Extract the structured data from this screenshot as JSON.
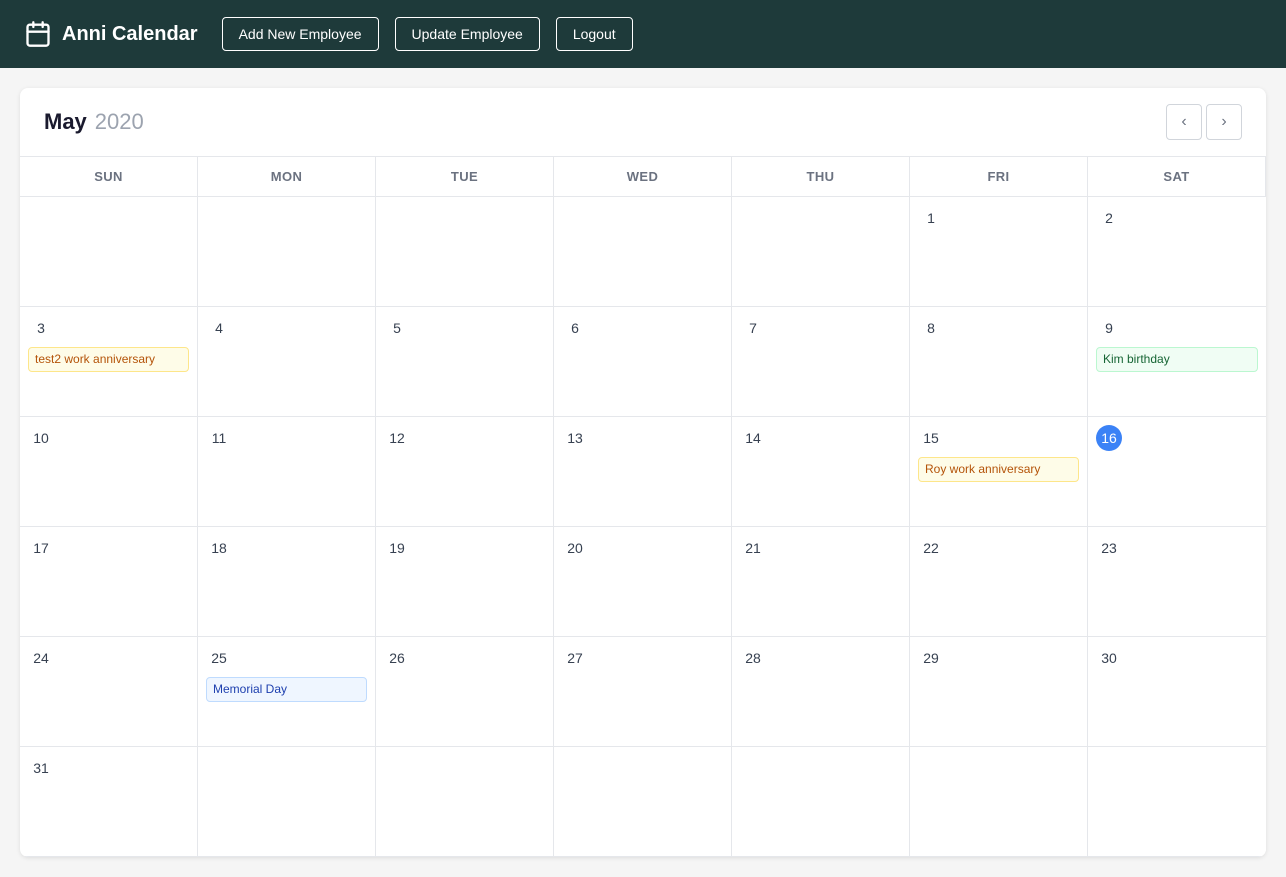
{
  "app": {
    "name": "Anni Calendar",
    "logo_icon": "calendar"
  },
  "header": {
    "add_employee_label": "Add New Employee",
    "update_employee_label": "Update Employee",
    "logout_label": "Logout"
  },
  "calendar": {
    "month": "May",
    "year": "2020",
    "nav_prev": "‹",
    "nav_next": "›",
    "day_headers": [
      "SUN",
      "MON",
      "TUE",
      "WED",
      "THU",
      "FRI",
      "SAT"
    ],
    "today_date": 16,
    "events": {
      "3": [
        {
          "label": "test2 work anniversary",
          "type": "anniversary"
        }
      ],
      "9": [
        {
          "label": "Kim birthday",
          "type": "birthday"
        }
      ],
      "15": [
        {
          "label": "Roy work anniversary",
          "type": "anniversary"
        }
      ],
      "25": [
        {
          "label": "Memorial Day",
          "type": "holiday"
        }
      ]
    },
    "weeks": [
      [
        null,
        null,
        null,
        null,
        null,
        1,
        2
      ],
      [
        3,
        4,
        5,
        6,
        7,
        8,
        9
      ],
      [
        10,
        11,
        12,
        13,
        14,
        15,
        16
      ],
      [
        17,
        18,
        19,
        20,
        21,
        22,
        23
      ],
      [
        24,
        25,
        26,
        27,
        28,
        29,
        30
      ],
      [
        31,
        null,
        null,
        null,
        null,
        null,
        null
      ]
    ]
  }
}
